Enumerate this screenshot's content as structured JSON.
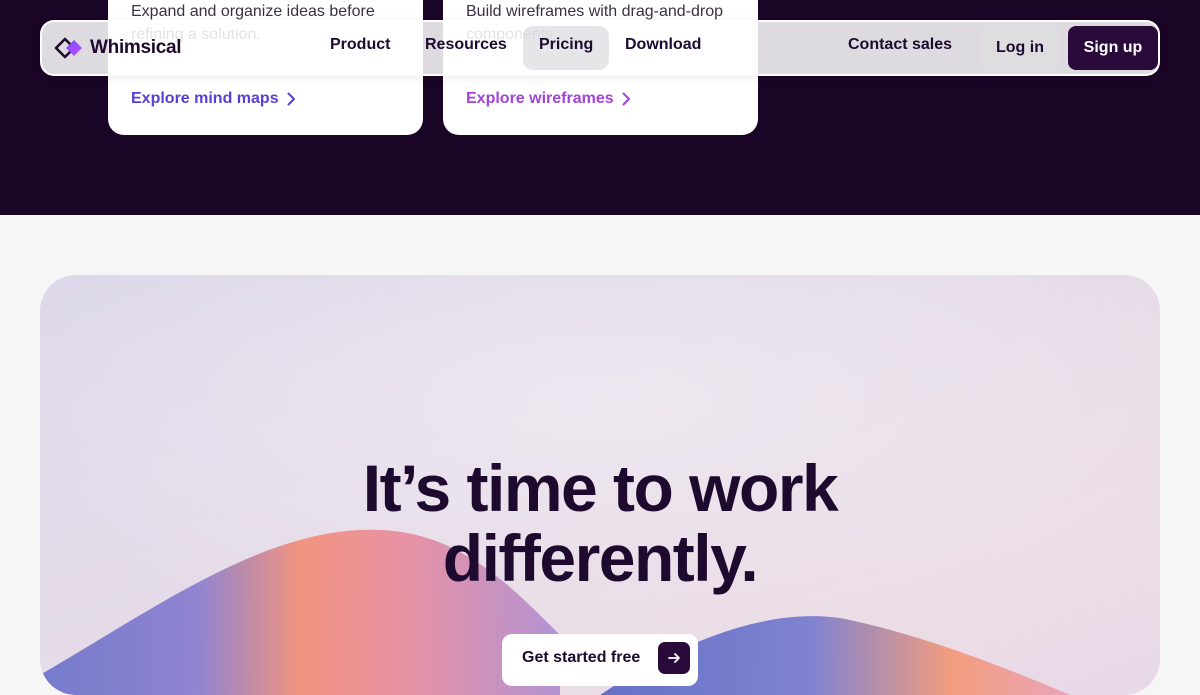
{
  "cards": [
    {
      "description": "Expand and organize ideas before refining a solution.",
      "link": "Explore mind maps"
    },
    {
      "description": "Build wireframes with drag-and-drop components.",
      "link": "Explore wireframes"
    }
  ],
  "nav": {
    "brand": "Whimsical",
    "items": [
      "Product",
      "Resources",
      "Pricing",
      "Download"
    ],
    "contact": "Contact sales",
    "login": "Log in",
    "signup": "Sign up"
  },
  "hero": {
    "title_line1": "It’s time to work",
    "title_line2": "differently.",
    "cta": "Get started free"
  },
  "colors": {
    "dark_band": "#1a0526",
    "mind_link": "#5a3fd6",
    "wire_link": "#a244d8",
    "primary": "#2a0a3a"
  },
  "icons": [
    "whimsical-logo-icon",
    "chevron-right-icon",
    "arrow-right-icon"
  ]
}
